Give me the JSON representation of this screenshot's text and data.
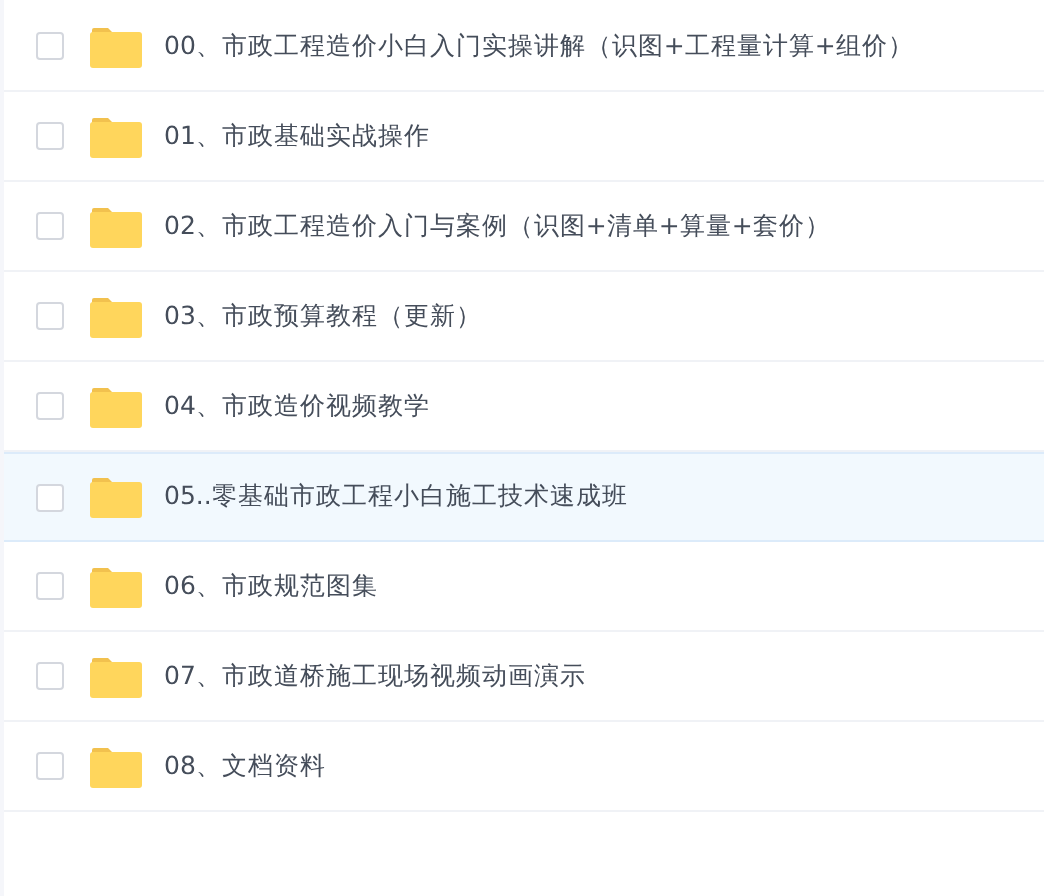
{
  "files": [
    {
      "name": "00、市政工程造价小白入门实操讲解（识图+工程量计算+组价）",
      "checked": false,
      "selected": false
    },
    {
      "name": "01、市政基础实战操作",
      "checked": false,
      "selected": false
    },
    {
      "name": "02、市政工程造价入门与案例（识图+清单+算量+套价）",
      "checked": false,
      "selected": false
    },
    {
      "name": "03、市政预算教程（更新）",
      "checked": false,
      "selected": false
    },
    {
      "name": "04、市政造价视频教学",
      "checked": false,
      "selected": false
    },
    {
      "name": "05..零基础市政工程小白施工技术速成班",
      "checked": false,
      "selected": true
    },
    {
      "name": "06、市政规范图集",
      "checked": false,
      "selected": false
    },
    {
      "name": "07、市政道桥施工现场视频动画演示",
      "checked": false,
      "selected": false
    },
    {
      "name": "08、文档资料",
      "checked": false,
      "selected": false
    }
  ]
}
